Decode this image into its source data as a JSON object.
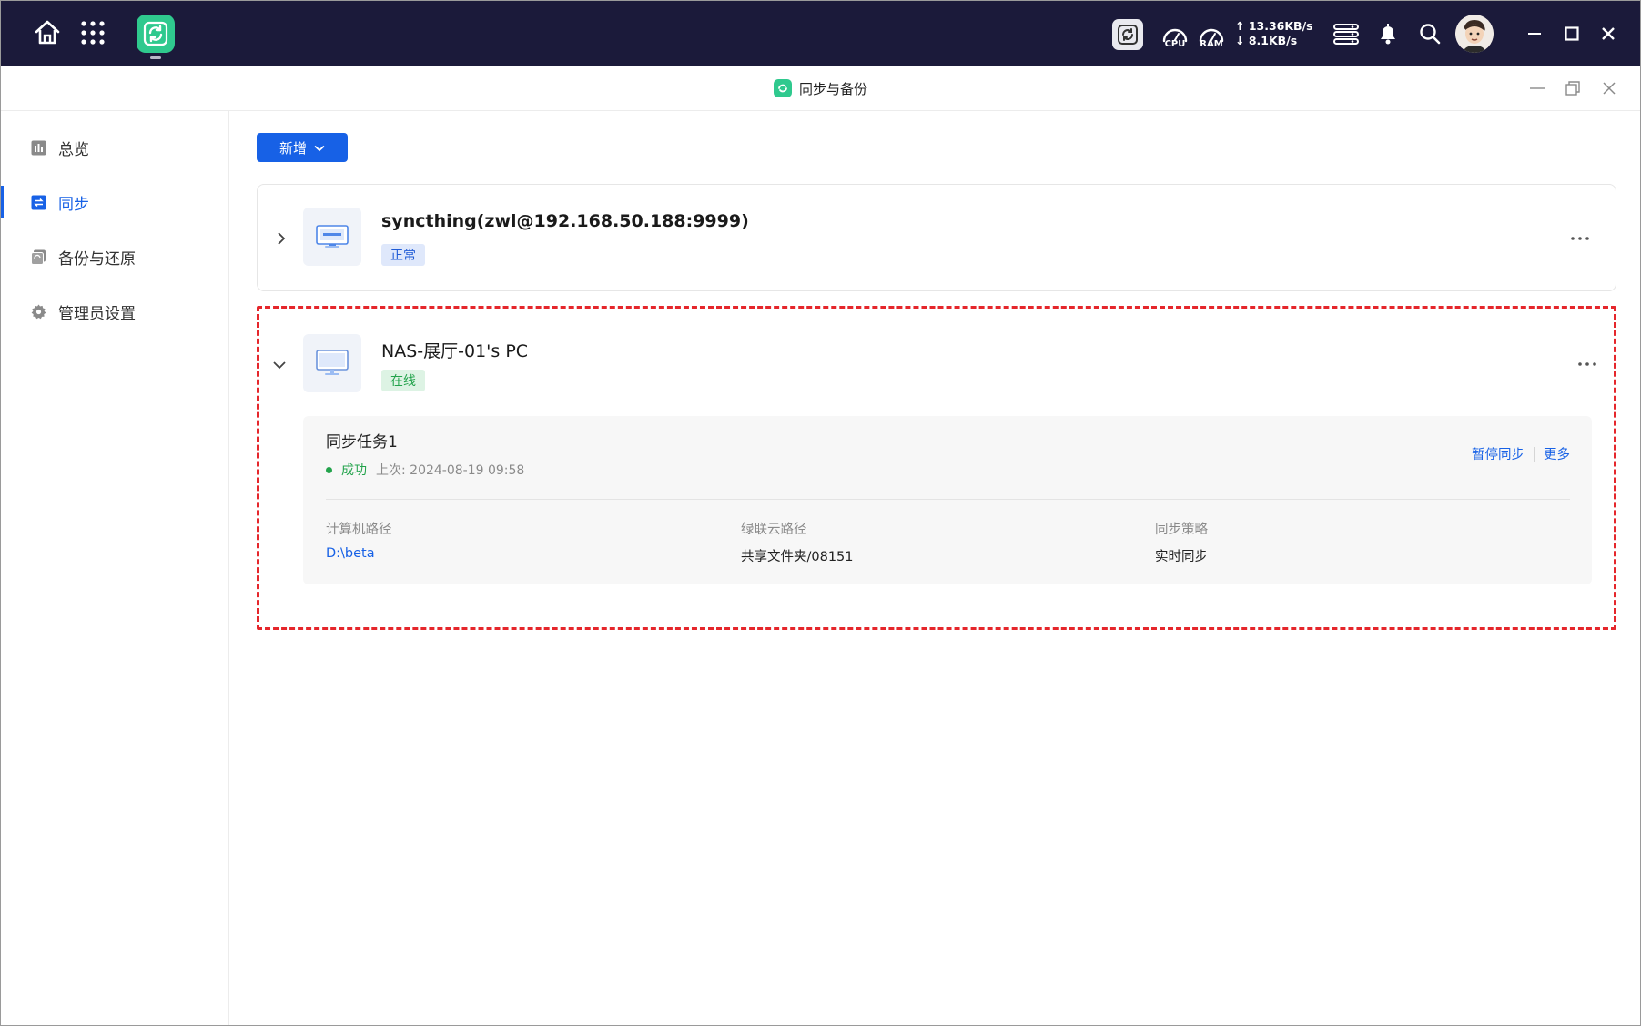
{
  "os_bar": {
    "network": {
      "upload": "↑ 13.36KB/s",
      "download": "↓ 8.1KB/s"
    },
    "gauges": {
      "cpu_label": "CPU",
      "ram_label": "RAM"
    },
    "icons": [
      "home-icon",
      "apps-grid-icon",
      "sync-app-icon",
      "sync-status-icon",
      "cpu-gauge-icon",
      "ram-gauge-icon",
      "task-manager-icon",
      "bell-icon",
      "search-icon",
      "avatar",
      "minimize-icon",
      "maximize-icon",
      "close-icon"
    ]
  },
  "window": {
    "title": "同步与备份"
  },
  "sidebar": {
    "items": [
      {
        "label": "总览",
        "icon": "chart-icon",
        "active": false
      },
      {
        "label": "同步",
        "icon": "sync-icon",
        "active": true
      },
      {
        "label": "备份与还原",
        "icon": "backup-icon",
        "active": false
      },
      {
        "label": "管理员设置",
        "icon": "gear-icon",
        "active": false
      }
    ]
  },
  "toolbar": {
    "add_label": "新增"
  },
  "devices": [
    {
      "name": "syncthing(zwl@192.168.50.188:9999)",
      "status": "正常",
      "icon": "nas-device-icon",
      "expanded": false
    },
    {
      "name": "NAS-展厅-01's PC",
      "status": "在线",
      "icon": "monitor-icon",
      "expanded": true,
      "task": {
        "name": "同步任务1",
        "result": "成功",
        "last_run": "上次: 2024-08-19 09:58",
        "actions": {
          "pause": "暂停同步",
          "more": "更多"
        },
        "fields": {
          "computer_path_label": "计算机路径",
          "computer_path": "D:\\beta",
          "cloud_path_label": "绿联云路径",
          "cloud_path": "共享文件夹/08151",
          "strategy_label": "同步策略",
          "strategy": "实时同步"
        }
      }
    }
  ],
  "colors": {
    "accent": "#1761e6",
    "success": "#23a34c",
    "highlight_border": "#e5262b",
    "os_bar": "#1b1a3a",
    "app_green": "#2fc98e"
  }
}
